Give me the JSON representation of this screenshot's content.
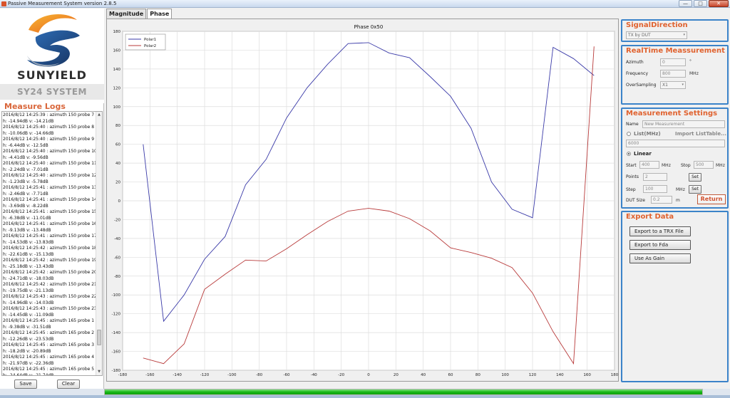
{
  "window": {
    "title": "Passive Measurement System  version 2.8.5"
  },
  "branding": {
    "company": "SUNYIELD",
    "system": "SY24 SYSTEM"
  },
  "logs": {
    "title": "Measure Logs",
    "lines": [
      "2016/8/12 14:25:39 : azimuth 150  probe 7",
      "h: -14.94dB v: -14.21dB",
      "2016/8/12 14:25:40 : azimuth 150  probe 8",
      "h: -10.06dB v: -14.66dB",
      "2016/8/12 14:25:40 : azimuth 150  probe 9",
      "h: -6.44dB v: -12.5dB",
      "2016/8/12 14:25:40 : azimuth 150  probe 10",
      "h: -4.41dB v: -9.56dB",
      "2016/8/12 14:25:40 : azimuth 150  probe 11",
      "h: -2.24dB v: -7.01dB",
      "2016/8/12 14:25:40 : azimuth 150  probe 12",
      "h: -1.23dB v: -5.78dB",
      "2016/8/12 14:25:41 : azimuth 150  probe 13",
      "h: -2.46dB v: -7.71dB",
      "2016/8/12 14:25:41 : azimuth 150  probe 14",
      "h: -3.69dB v: -8.22dB",
      "2016/8/12 14:25:41 : azimuth 150  probe 15",
      "h: -6.38dB v: -11.01dB",
      "2016/8/12 14:25:41 : azimuth 150  probe 16",
      "h: -9.13dB v: -13.48dB",
      "2016/8/12 14:25:41 : azimuth 150  probe 17",
      "h: -14.53dB v: -13.83dB",
      "2016/8/12 14:25:42 : azimuth 150  probe 18",
      "h: -22.61dB v: -15.13dB",
      "2016/8/12 14:25:42 : azimuth 150  probe 19",
      "h: -25.18dB v: -13.43dB",
      "2016/8/12 14:25:42 : azimuth 150  probe 20",
      "h: -24.71dB v: -18.03dB",
      "2016/8/12 14:25:42 : azimuth 150  probe 21",
      "h: -19.75dB v: -21.13dB",
      "2016/8/12 14:25:43 : azimuth 150  probe 22",
      "h: -14.96dB v: -14.03dB",
      "2016/8/12 14:25:43 : azimuth 150  probe 23",
      "h: -14.45dB v: -11.09dB",
      "2016/8/12 14:25:45 : azimuth 165  probe 1",
      "h: -9.38dB v: -31.51dB",
      "2016/8/12 14:25:45 : azimuth 165  probe 2",
      "h: -12.26dB v: -23.53dB",
      "2016/8/12 14:25:45 : azimuth 165  probe 3",
      "h: -18.2dB v: -20.89dB",
      "2016/8/12 14:25:45 : azimuth 165  probe 4",
      "h: -21.97dB v: -22.36dB",
      "2016/8/12 14:25:45 : azimuth 165  probe 5",
      "h: -24.64dB v: -21.74dB",
      "2016/8/12 14:25:46 : azimuth 165  probe 6"
    ],
    "save_label": "Save",
    "clear_label": "Clear"
  },
  "tabs": [
    {
      "label": "Magnitude",
      "active": false
    },
    {
      "label": "Phase",
      "active": true
    }
  ],
  "signal_direction": {
    "title": "SignalDirection",
    "value": "TX by DUT"
  },
  "realtime": {
    "title": "RealTime Meassurement",
    "azimuth_label": "Azimuth",
    "azimuth_value": "0",
    "azimuth_unit": "°",
    "frequency_label": "Frequency",
    "frequency_value": "800",
    "frequency_unit": "MHz",
    "oversampling_label": "OverSampling",
    "oversampling_value": "X1"
  },
  "settings": {
    "title": "Measurement Settings",
    "name_label": "Name",
    "name_value": "New Measurement",
    "list_label": "List(MHz)",
    "import_label": "Import ListTable...",
    "list_value": "6000",
    "linear_label": "Linear",
    "start_label": "Start",
    "start_value": "400",
    "start_unit": "MHz",
    "stop_label": "Stop",
    "stop_value": "500",
    "stop_unit": "MHz",
    "points_label": "Points",
    "points_value": "2",
    "points_set": "Set",
    "step_label": "Step",
    "step_value": "100",
    "step_unit": "MHz",
    "step_set": "Set",
    "dut_label": "DUT Size",
    "dut_value": "0.2",
    "dut_unit": "m",
    "return_label": "Return"
  },
  "export": {
    "title": "Export Data",
    "trx_label": "Export to a TRX File",
    "fda_label": "Export to Fda",
    "gain_label": "Use As Gain"
  },
  "progress": {
    "value": 1.0
  },
  "colors": {
    "accent_blue": "#3b83c9",
    "title_orange": "#e0622f",
    "series1": "#3a3aa8",
    "series2": "#b83a3a"
  },
  "chart_data": {
    "type": "line",
    "title": "Phase 0x50",
    "xlabel": "",
    "ylabel": "",
    "xlim": [
      -180,
      180
    ],
    "ylim": [
      -180,
      180
    ],
    "xticks": [
      -180,
      -160,
      -140,
      -120,
      -100,
      -80,
      -60,
      -40,
      -20,
      0,
      20,
      40,
      60,
      80,
      100,
      120,
      140,
      160,
      180
    ],
    "yticks": [
      -180,
      -160,
      -140,
      -120,
      -100,
      -80,
      -60,
      -40,
      -20,
      0,
      20,
      40,
      60,
      80,
      100,
      120,
      140,
      160,
      180
    ],
    "grid": true,
    "legend": "top-left",
    "series": [
      {
        "name": "Polar1",
        "color": "#3a3aa8",
        "x": [
          -165,
          -150,
          -135,
          -120,
          -105,
          -90,
          -75,
          -60,
          -45,
          -30,
          -15,
          0,
          15,
          30,
          45,
          60,
          75,
          90,
          105,
          120,
          135,
          150,
          165
        ],
        "y": [
          60,
          -128,
          -100,
          -62,
          -38,
          17,
          44,
          88,
          120,
          145,
          167,
          168,
          157,
          152,
          132,
          111,
          77,
          20,
          -9,
          -18,
          163,
          151,
          133
        ]
      },
      {
        "name": "Polar2",
        "color": "#b83a3a",
        "x": [
          -165,
          -150,
          -135,
          -120,
          -105,
          -90,
          -75,
          -60,
          -45,
          -30,
          -15,
          0,
          15,
          30,
          45,
          60,
          75,
          90,
          105,
          120,
          135,
          150,
          165
        ],
        "y": [
          -167,
          -173,
          -152,
          -94,
          -78,
          -63,
          -64,
          -51,
          -36,
          -22,
          -11,
          -8,
          -11,
          -19,
          -32,
          -50,
          -55,
          -61,
          -71,
          -98,
          -139,
          -173,
          164
        ]
      }
    ]
  }
}
